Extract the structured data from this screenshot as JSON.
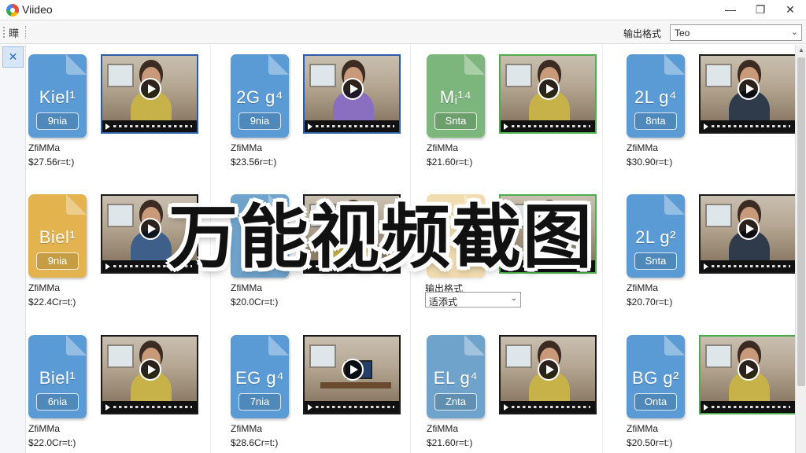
{
  "window": {
    "title": "Viideo",
    "minimize": "—",
    "maximize": "❐",
    "close": "✕",
    "logo_icon": "app-logo"
  },
  "toolbar": {
    "icon_glyph": "瞱",
    "format_label": "输出格式",
    "format_value": "Teo",
    "dropdown_arrow": "⌄"
  },
  "sidebar": {
    "tool_glyph": "✕"
  },
  "overlay": {
    "banner": "万能视频截图",
    "format_label": "输出格式",
    "format_value": "适添式",
    "arrow": "⌄"
  },
  "files": [
    {
      "big": "Kiel¹",
      "small": "9nia",
      "color": "#5b9bd5",
      "name": "ZfiMMa",
      "size": "$27.56r=t:)"
    },
    {
      "big": "2G g⁴",
      "small": "9nia",
      "color": "#5b9bd5",
      "name": "ZfiMMa",
      "size": "$23.56r=t:)"
    },
    {
      "big": "Mᵢ¹⁴",
      "small": "Snta",
      "color": "#7cb67c",
      "name": "ZfiMMa",
      "size": "$21.60r=t:)"
    },
    {
      "big": "2L g⁴",
      "small": "8nta",
      "color": "#5b9bd5",
      "name": "ZfiMMa",
      "size": "$30.90r=t:)"
    },
    {
      "big": "Biel¹",
      "small": "9nia",
      "color": "#e2b34f",
      "name": "ZfiMMa",
      "size": "$22.4Cr=t:)"
    },
    {
      "big": "T",
      "small": "",
      "color": "#6fa3cb",
      "name": "ZfiMMa",
      "size": "$20.0Cr=t:)"
    },
    {
      "big": "",
      "small": "",
      "color": "#e2b34f",
      "name": "",
      "size": ""
    },
    {
      "big": "2L g²",
      "small": "Snta",
      "color": "#5b9bd5",
      "name": "ZfiMMa",
      "size": "$20.70r=t:)"
    },
    {
      "big": "Biel¹",
      "small": "6nia",
      "color": "#5b9bd5",
      "name": "ZfiMMa",
      "size": "$22.0Cr=t:)"
    },
    {
      "big": "EG g⁴",
      "small": "7nia",
      "color": "#5b9bd5",
      "name": "ZfiMMa",
      "size": "$28.6Cr=t:)"
    },
    {
      "big": "EL g⁴",
      "small": "Znta",
      "color": "#6fa3cb",
      "name": "ZfiMMa",
      "size": "$21.60r=t:)"
    },
    {
      "big": "BG g²",
      "small": "Onta",
      "color": "#5b9bd5",
      "name": "ZfiMMa",
      "size": "$20.50r=t:)"
    }
  ]
}
